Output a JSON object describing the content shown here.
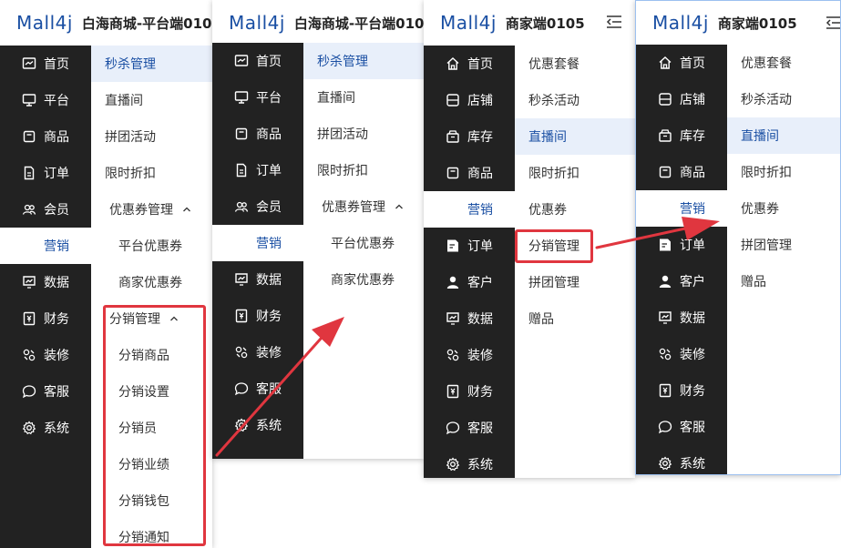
{
  "colors": {
    "brand": "#1a4fa3",
    "sidebar_bg": "#222222",
    "active_sub_bg": "#e8effa",
    "highlight": "#e0363f"
  },
  "panel1": {
    "logo": "Mall4j",
    "title": "白海商城-平台端010",
    "sidebar": [
      {
        "label": "首页",
        "icon": "home-screen-icon"
      },
      {
        "label": "平台",
        "icon": "monitor-icon"
      },
      {
        "label": "商品",
        "icon": "box-icon"
      },
      {
        "label": "订单",
        "icon": "document-icon"
      },
      {
        "label": "会员",
        "icon": "members-icon"
      },
      {
        "label": "营销",
        "icon": "gift-icon"
      },
      {
        "label": "数据",
        "icon": "chart-icon"
      },
      {
        "label": "财务",
        "icon": "finance-icon"
      },
      {
        "label": "装修",
        "icon": "decorate-icon"
      },
      {
        "label": "客服",
        "icon": "chat-icon"
      },
      {
        "label": "系统",
        "icon": "settings-icon"
      }
    ],
    "submenu": [
      {
        "label": "秒杀管理"
      },
      {
        "label": "直播间"
      },
      {
        "label": "拼团活动"
      },
      {
        "label": "限时折扣"
      },
      {
        "label": "优惠券管理"
      },
      {
        "label": "平台优惠券"
      },
      {
        "label": "商家优惠券"
      },
      {
        "label": "分销管理"
      },
      {
        "label": "分销商品"
      },
      {
        "label": "分销设置"
      },
      {
        "label": "分销员"
      },
      {
        "label": "分销业绩"
      },
      {
        "label": "分销钱包"
      },
      {
        "label": "分销通知"
      }
    ]
  },
  "panel2": {
    "logo": "Mall4j",
    "title": "白海商城-平台端010",
    "sidebar": [
      {
        "label": "首页"
      },
      {
        "label": "平台"
      },
      {
        "label": "商品"
      },
      {
        "label": "订单"
      },
      {
        "label": "会员"
      },
      {
        "label": "营销"
      },
      {
        "label": "数据"
      },
      {
        "label": "财务"
      },
      {
        "label": "装修"
      },
      {
        "label": "客服"
      },
      {
        "label": "系统"
      }
    ],
    "submenu": [
      {
        "label": "秒杀管理"
      },
      {
        "label": "直播间"
      },
      {
        "label": "拼团活动"
      },
      {
        "label": "限时折扣"
      },
      {
        "label": "优惠券管理"
      },
      {
        "label": "平台优惠券"
      },
      {
        "label": "商家优惠券"
      }
    ]
  },
  "panel3": {
    "logo": "Mall4j",
    "title": "商家端0105",
    "sidebar": [
      {
        "label": "首页"
      },
      {
        "label": "店铺"
      },
      {
        "label": "库存"
      },
      {
        "label": "商品"
      },
      {
        "label": "营销"
      },
      {
        "label": "订单"
      },
      {
        "label": "客户"
      },
      {
        "label": "数据"
      },
      {
        "label": "装修"
      },
      {
        "label": "财务"
      },
      {
        "label": "客服"
      },
      {
        "label": "系统"
      }
    ],
    "submenu": [
      {
        "label": "优惠套餐"
      },
      {
        "label": "秒杀活动"
      },
      {
        "label": "直播间"
      },
      {
        "label": "限时折扣"
      },
      {
        "label": "优惠券"
      },
      {
        "label": "分销管理"
      },
      {
        "label": "拼团管理"
      },
      {
        "label": "赠品"
      }
    ]
  },
  "panel4": {
    "logo": "Mall4j",
    "title": "商家端0105",
    "sidebar": [
      {
        "label": "首页"
      },
      {
        "label": "店铺"
      },
      {
        "label": "库存"
      },
      {
        "label": "商品"
      },
      {
        "label": "营销"
      },
      {
        "label": "订单"
      },
      {
        "label": "客户"
      },
      {
        "label": "数据"
      },
      {
        "label": "装修"
      },
      {
        "label": "财务"
      },
      {
        "label": "客服"
      },
      {
        "label": "系统"
      }
    ],
    "submenu": [
      {
        "label": "优惠套餐"
      },
      {
        "label": "秒杀活动"
      },
      {
        "label": "直播间"
      },
      {
        "label": "限时折扣"
      },
      {
        "label": "优惠券"
      },
      {
        "label": "拼团管理"
      },
      {
        "label": "赠品"
      }
    ]
  }
}
